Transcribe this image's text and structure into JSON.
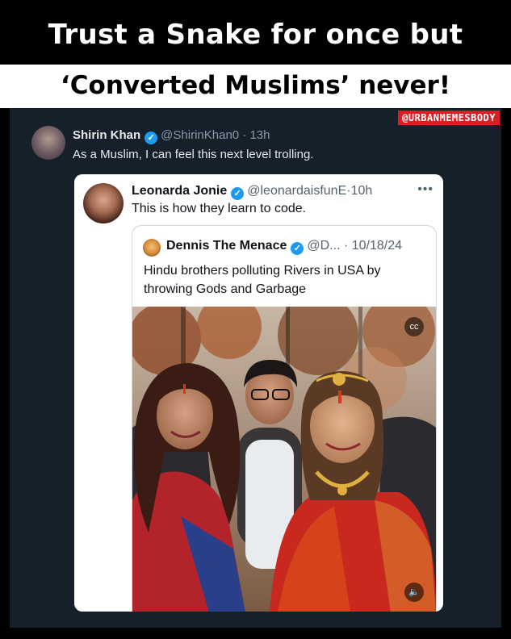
{
  "headline": {
    "line1": "Trust a Snake for once but",
    "line2": "‘Converted Muslims’ never!"
  },
  "watermark": "@URBANMEMESBODY",
  "tweet": {
    "name": "Shirin Khan",
    "handle": "@ShirinKhan0",
    "separator": "·",
    "time": "13h",
    "text": "As a Muslim, I can feel this next level trolling."
  },
  "quoted_tweet": {
    "name": "Leonarda Jonie",
    "handle": "@leonardaisfunE",
    "separator": "·",
    "time": "10h",
    "text": "This is how they learn to code.",
    "more_icon": "•••"
  },
  "nested_quote": {
    "name": "Dennis The Menace",
    "handle": "@D...",
    "separator": "·",
    "date": "10/18/24",
    "text": "Hindu brothers polluting Rivers in USA by throwing Gods and Garbage"
  },
  "media": {
    "captions_icon": "cc",
    "mute_icon": "🔈"
  },
  "icons": {
    "verified": "✓"
  },
  "colors": {
    "panel_bg": "#15202b",
    "verified_blue": "#1d9bf0",
    "watermark_red": "#d91f26"
  }
}
